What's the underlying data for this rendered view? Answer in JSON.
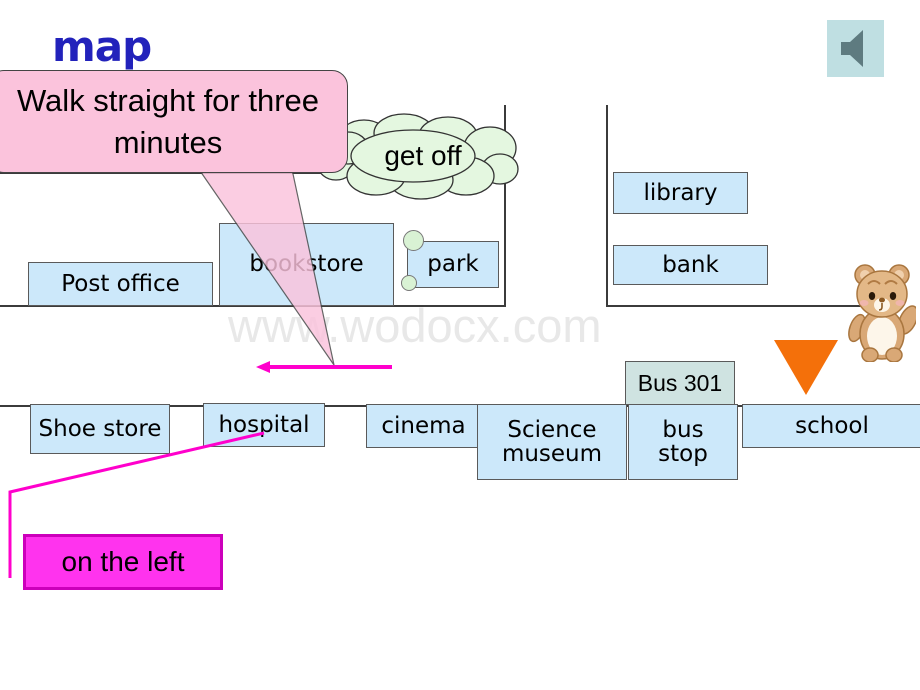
{
  "slide": {
    "title": "map",
    "watermark": "www.wodocx.com",
    "background_color": "#ffffff"
  },
  "audio_button": {
    "icon": "speaker-icon",
    "background_color": "#bfdfe2",
    "icon_color": "#5e7b80"
  },
  "callouts": {
    "instruction_bubble": {
      "text": "Walk straight for three minutes",
      "fill_color": "#fbc3dc",
      "shape": "rounded-rectangle-with-tail"
    },
    "cloud_bubble": {
      "text": "get off",
      "fill_color": "#e4f7e0",
      "shape": "cloud"
    },
    "left_callout": {
      "text": "on the left",
      "fill_color": "#ff33ee",
      "border_color": "#cc00bb"
    }
  },
  "map": {
    "buildings": [
      {
        "label": "Post office",
        "row": "upper"
      },
      {
        "label": "bookstore",
        "row": "upper"
      },
      {
        "label": "park",
        "row": "upper"
      },
      {
        "label": "library",
        "row": "upper"
      },
      {
        "label": "bank",
        "row": "upper"
      },
      {
        "label": "Shoe store",
        "row": "lower"
      },
      {
        "label": "hospital",
        "row": "lower"
      },
      {
        "label": "cinema",
        "row": "lower"
      },
      {
        "label": "Science\nmuseum",
        "row": "lower"
      },
      {
        "label": "bus\nstop",
        "row": "lower"
      },
      {
        "label": "school",
        "row": "lower"
      }
    ],
    "bus_sign": "Bus 301",
    "building_fill_color": "#cce8fa",
    "bus_sign_fill_color": "#cfe3e1",
    "marker": {
      "shape": "down-triangle",
      "color": "#f4700a"
    },
    "direction_arrow": {
      "color": "#ff00cc",
      "direction": "left"
    },
    "mascot": "teddy-bear"
  }
}
